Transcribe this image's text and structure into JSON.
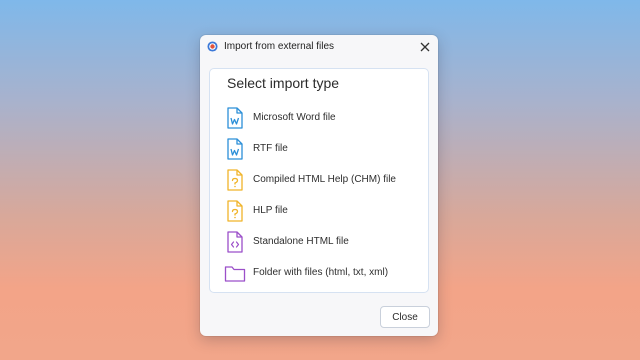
{
  "dialog": {
    "title": "Import from external files",
    "heading": "Select import type",
    "close_label": "Close"
  },
  "items": [
    {
      "label": "Microsoft Word file",
      "icon": "word-file-icon",
      "color": "#2b8fd8"
    },
    {
      "label": "RTF file",
      "icon": "rtf-file-icon",
      "color": "#2b8fd8"
    },
    {
      "label": "Compiled HTML Help (CHM) file",
      "icon": "chm-file-icon",
      "color": "#f0b429"
    },
    {
      "label": "HLP file",
      "icon": "hlp-file-icon",
      "color": "#f0b429"
    },
    {
      "label": "Standalone HTML file",
      "icon": "html-file-icon",
      "color": "#9b4fc9"
    },
    {
      "label": "Folder with files (html, txt, xml)",
      "icon": "folder-icon",
      "color": "#9b4fc9"
    }
  ]
}
